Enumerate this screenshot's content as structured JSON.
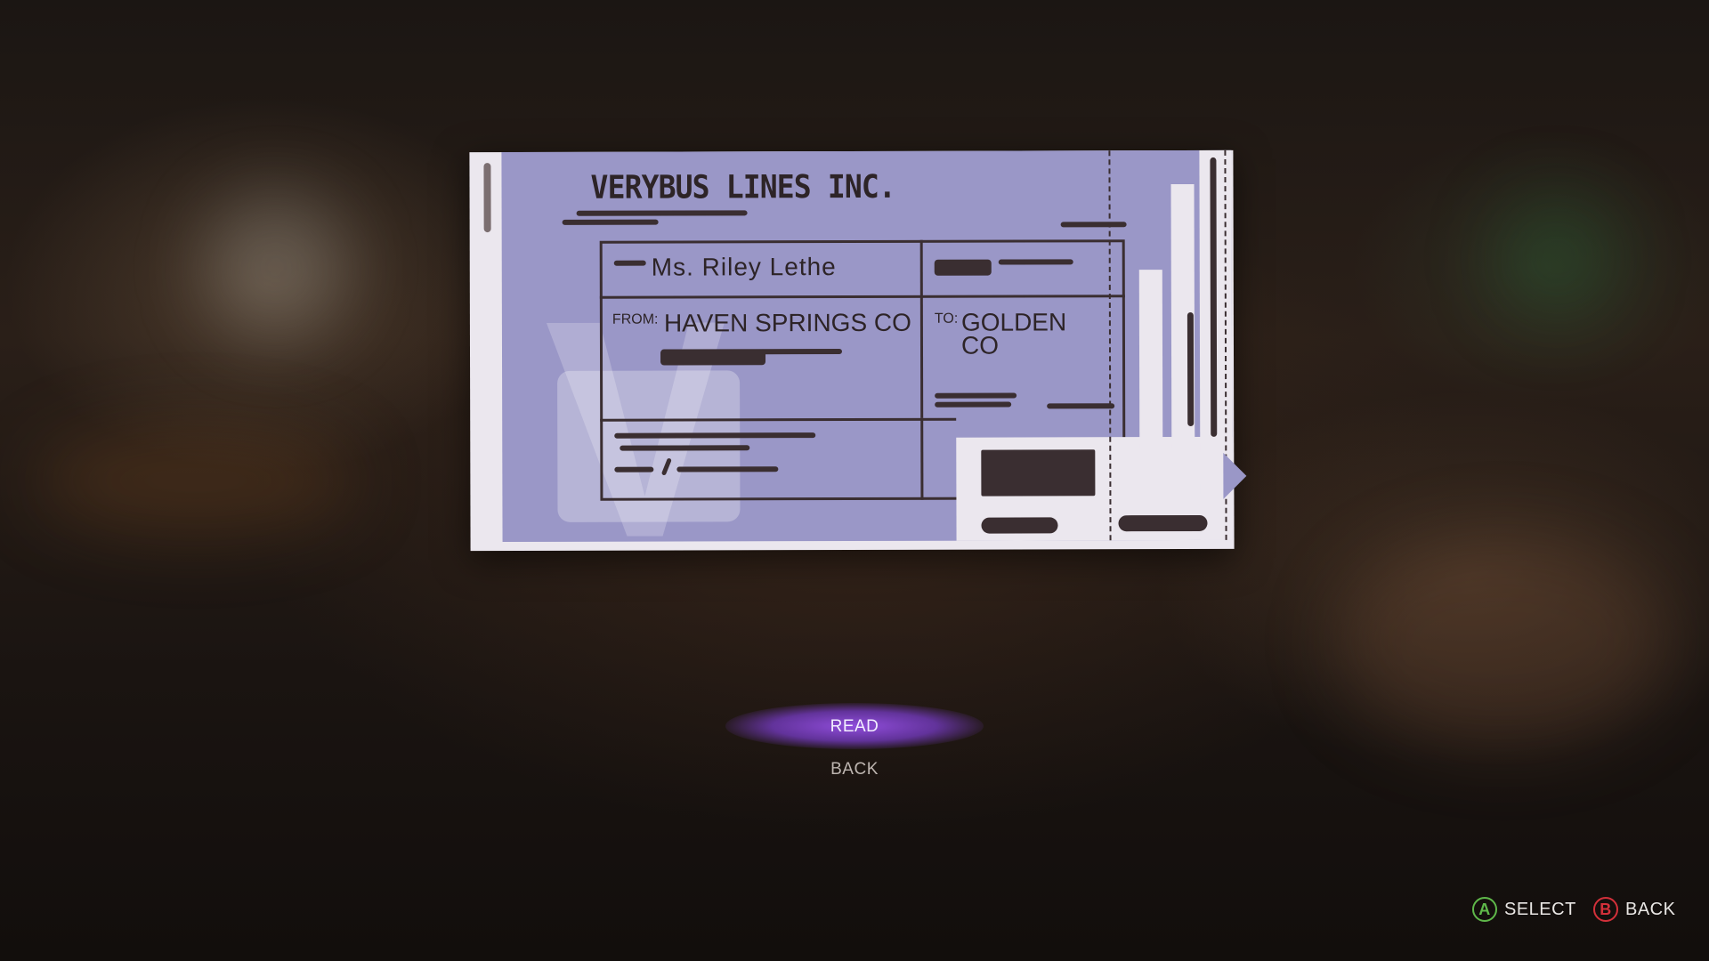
{
  "ticket": {
    "company": "VERYBUS LINES INC.",
    "passenger_name": "Ms. Riley Lethe",
    "from_label": "FROM:",
    "from_value": "HAVEN SPRINGS CO",
    "to_label": "TO:",
    "to_value_line1": "GOLDEN",
    "to_value_line2": "CO"
  },
  "menu": {
    "items": [
      {
        "label": "READ",
        "selected": true
      },
      {
        "label": "BACK",
        "selected": false
      }
    ]
  },
  "prompts": {
    "select": {
      "button": "A",
      "label": "SELECT",
      "color": "#5fb84a"
    },
    "back": {
      "button": "B",
      "label": "BACK",
      "color": "#d3303a"
    }
  },
  "colors": {
    "ticket_body": "#9a97c7",
    "ticket_paper": "#ebe7ee",
    "highlight": "#9650e6"
  }
}
